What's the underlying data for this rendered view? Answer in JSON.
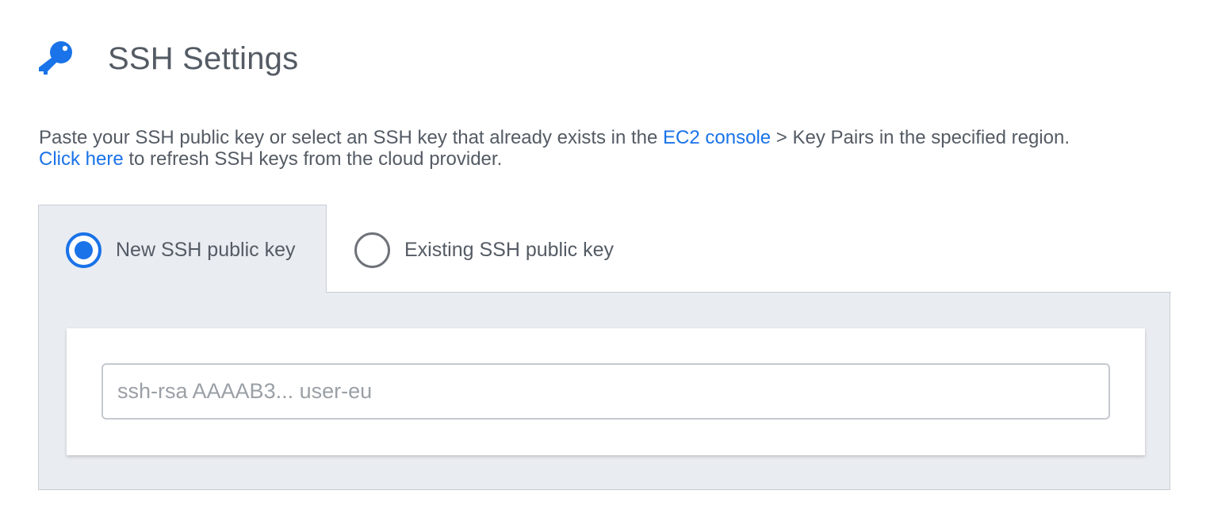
{
  "header": {
    "title": "SSH Settings",
    "icon": "key-icon",
    "icon_color": "#1a73e8"
  },
  "description": {
    "line1_before": "Paste your SSH public key or select an SSH key that already exists in the ",
    "ec2_link": "EC2 console",
    "line1_after": " > Key Pairs in the specified region.",
    "refresh_link": "Click here",
    "line2_after": " to refresh SSH keys from the cloud provider."
  },
  "key_options": {
    "selected": "new",
    "new_label": "New SSH public key",
    "existing_label": "Existing SSH public key"
  },
  "ssh_input": {
    "value": "",
    "placeholder": "ssh-rsa AAAAB3... user-eu"
  },
  "colors": {
    "accent": "#1a73e8",
    "text": "#545b64",
    "panel_bg": "#e9ecf1"
  }
}
